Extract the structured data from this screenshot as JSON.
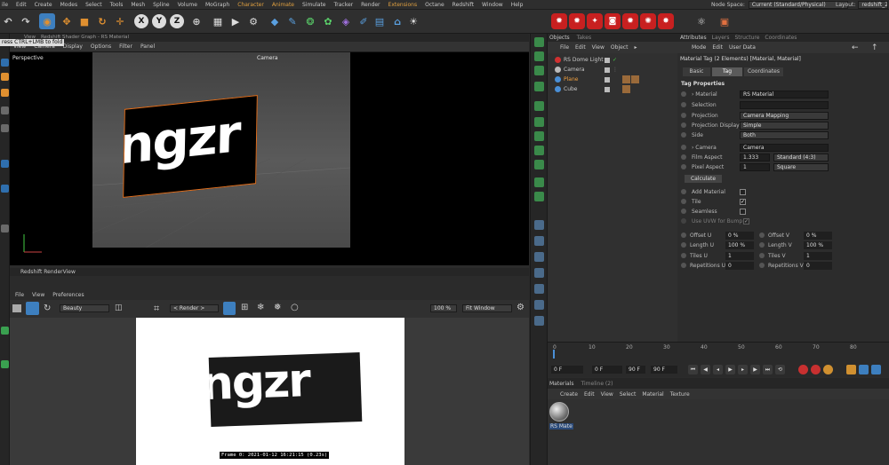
{
  "menubar": {
    "items": [
      "ile",
      "Edit",
      "Create",
      "Modes",
      "Select",
      "Tools",
      "Mesh",
      "Spline",
      "Volume",
      "MoGraph",
      "Character",
      "Animate",
      "Simulate",
      "Tracker",
      "Render",
      "Extensions",
      "Octane",
      "Redshift",
      "Window",
      "Help"
    ],
    "node_space_label": "Node Space:",
    "node_space_value": "Current (Standard/Physical)",
    "layout_label": "Layout:",
    "layout_value": "redshift_2"
  },
  "viewport": {
    "tabs": [
      "View",
      "Redshift Shader Graph - RS Material"
    ],
    "tooltip": "ress CTRL+LMB to fold",
    "menu": [
      "View",
      "Camera",
      "Display",
      "Options",
      "Filter",
      "Panel"
    ],
    "label": "Perspective",
    "camera_label": "Camera",
    "plane_text": "ngzr"
  },
  "renderview": {
    "title": "Redshift RenderView",
    "menu": [
      "File",
      "View",
      "Preferences"
    ],
    "aov_value": "Beauty",
    "render_value": "< Render >",
    "zoom_value": "100 %",
    "fit_value": "Fit Window",
    "render_text": "ngzr",
    "frame_info": "Frame 0: 2021-01-12 16:21:15 (0.23s)"
  },
  "objects": {
    "tabs": [
      "Objects",
      "Takes"
    ],
    "menu": [
      "File",
      "Edit",
      "View",
      "Object",
      "▸"
    ],
    "rows": [
      {
        "name": "RS Dome Light",
        "color": "#d03030"
      },
      {
        "name": "Camera",
        "color": "#bbbbbb"
      },
      {
        "name": "Plane",
        "color": "#4a8fd6",
        "selected": true
      },
      {
        "name": "Cube",
        "color": "#4a8fd6"
      }
    ]
  },
  "attributes": {
    "tabs": [
      "Attributes",
      "Layers",
      "Structure",
      "Coordinates"
    ],
    "menu": [
      "Mode",
      "Edit",
      "User Data"
    ],
    "header": "Material Tag (2 Elements) [Material, Material]",
    "subtabs": [
      "Basic",
      "Tag",
      "Coordinates"
    ],
    "section": "Tag Properties",
    "props": [
      {
        "label": "› Material",
        "value": "RS Material"
      },
      {
        "label": "Selection",
        "value": ""
      },
      {
        "label": "Projection",
        "value": "Camera Mapping"
      },
      {
        "label": "Projection Display",
        "value": "Simple"
      },
      {
        "label": "Side",
        "value": "Both"
      },
      {
        "label": "› Camera",
        "value": "Camera"
      },
      {
        "label": "Film Aspect",
        "value": "1.333",
        "extra": "Standard (4:3)"
      },
      {
        "label": "Pixel Aspect",
        "value": "1",
        "extra": "Square"
      }
    ],
    "calculate_label": "Calculate",
    "checks": [
      {
        "label": "Add Material",
        "checked": false
      },
      {
        "label": "Tile",
        "checked": true
      },
      {
        "label": "Seamless",
        "checked": false
      },
      {
        "label": "Use UVW for Bump",
        "checked": true
      }
    ],
    "pairs": [
      {
        "l1": "Offset U",
        "v1": "0 %",
        "l2": "Offset V",
        "v2": "0 %"
      },
      {
        "l1": "Length U",
        "v1": "100 %",
        "l2": "Length V",
        "v2": "100 %"
      },
      {
        "l1": "Tiles U",
        "v1": "1",
        "l2": "Tiles V",
        "v2": "1"
      },
      {
        "l1": "Repetitions U",
        "v1": "0",
        "l2": "Repetitions V",
        "v2": "0"
      }
    ]
  },
  "timeline": {
    "ticks": [
      "0",
      "10",
      "20",
      "30",
      "40",
      "50",
      "60",
      "70",
      "80"
    ],
    "start": "0 F",
    "current": "0 F",
    "end": "90 F",
    "end2": "90 F"
  },
  "materials": {
    "tabs": [
      "Materials",
      "Timeline (2)"
    ],
    "menu": [
      "Create",
      "Edit",
      "View",
      "Select",
      "Material",
      "Texture"
    ],
    "item_name": "RS Mate"
  }
}
